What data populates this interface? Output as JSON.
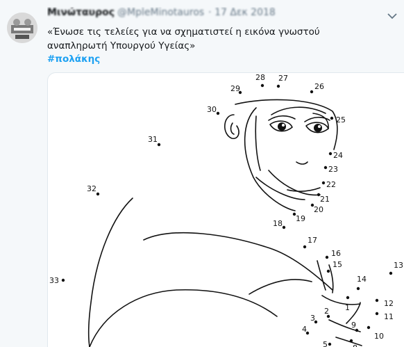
{
  "tweet": {
    "display_name": "Μινώταυρος",
    "handle": "@MpleMinotauros",
    "time": "· 17 Δεκ 2018",
    "text": "«Ένωσε τις τελείες για να σχηματιστεί η εικόνα γνωστού αναπληρωτή Υπουργού Υγείας»",
    "hashtag": "#πολάκης"
  },
  "icons": {
    "caret": "chevron-down-icon",
    "avatar": "avatar-image"
  },
  "colors": {
    "background": "#f5f8fa",
    "hashtag": "#1da1f2",
    "secondary_text": "#657786"
  },
  "dots": [
    {
      "n": "1"
    },
    {
      "n": "2"
    },
    {
      "n": "3"
    },
    {
      "n": "4"
    },
    {
      "n": "5"
    },
    {
      "n": "8"
    },
    {
      "n": "9"
    },
    {
      "n": "10"
    },
    {
      "n": "11"
    },
    {
      "n": "12"
    },
    {
      "n": "13"
    },
    {
      "n": "14"
    },
    {
      "n": "15"
    },
    {
      "n": "16"
    },
    {
      "n": "17"
    },
    {
      "n": "18"
    },
    {
      "n": "19"
    },
    {
      "n": "20"
    },
    {
      "n": "21"
    },
    {
      "n": "22"
    },
    {
      "n": "23"
    },
    {
      "n": "24"
    },
    {
      "n": "25"
    },
    {
      "n": "26"
    },
    {
      "n": "27"
    },
    {
      "n": "28"
    },
    {
      "n": "29"
    },
    {
      "n": "30"
    },
    {
      "n": "31"
    },
    {
      "n": "32"
    },
    {
      "n": "33"
    }
  ]
}
